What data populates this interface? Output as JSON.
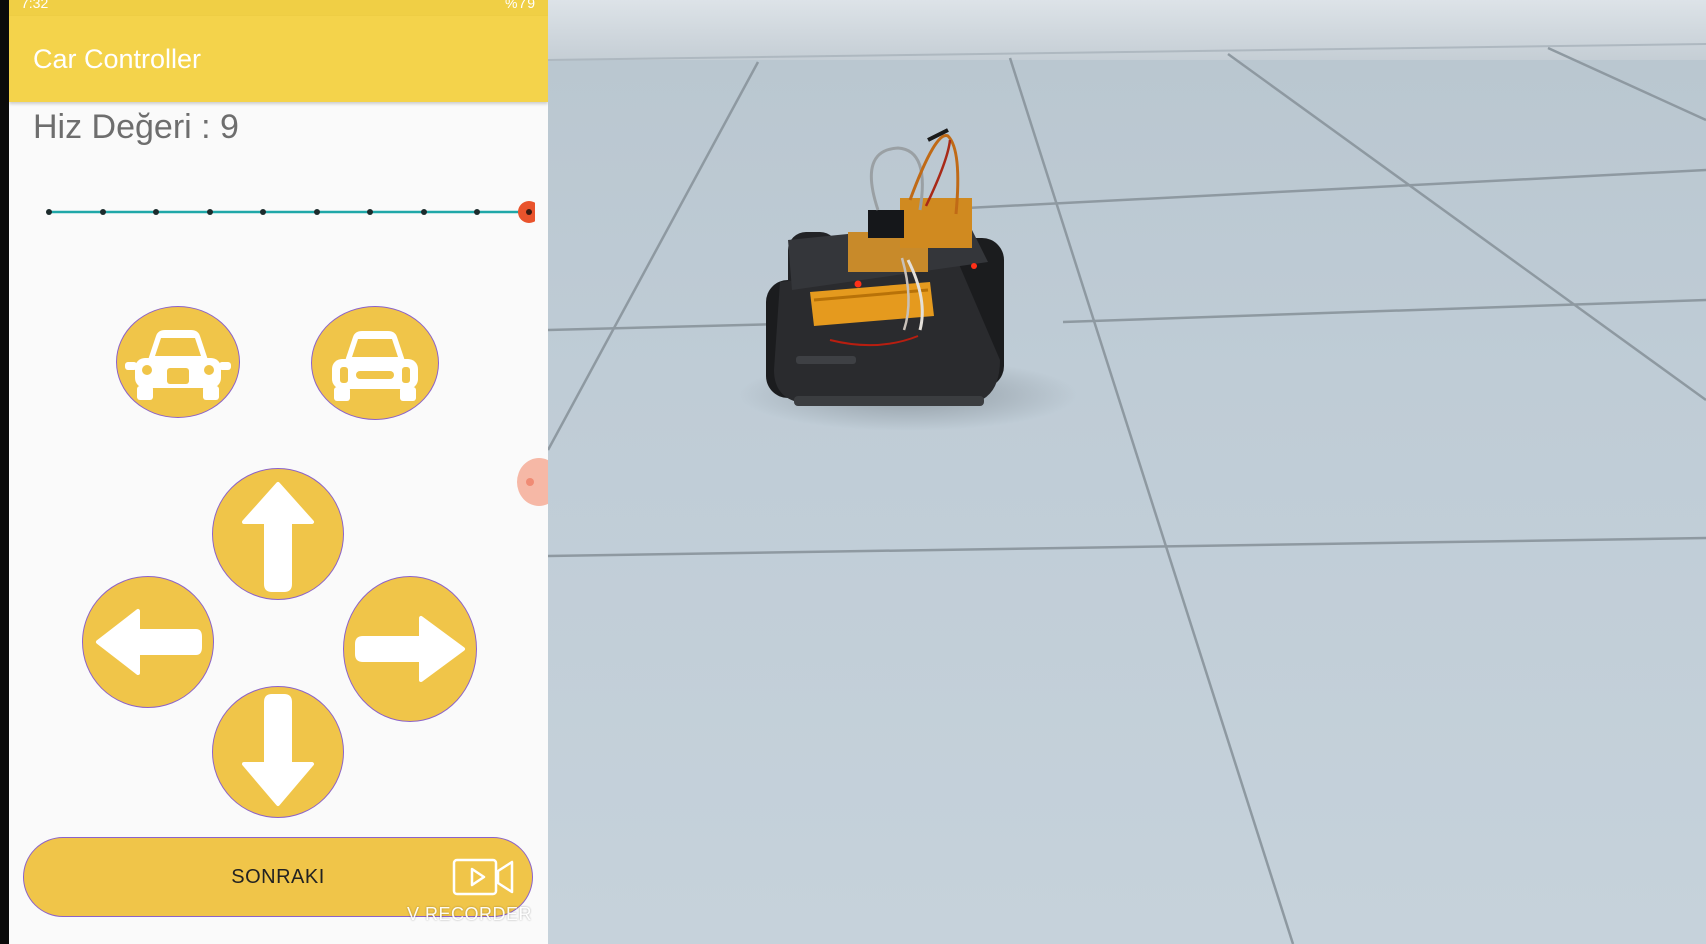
{
  "status_bar": {
    "time": "7:32",
    "battery": "%79"
  },
  "app_bar": {
    "title": "Car Controller"
  },
  "speed": {
    "label": "Hiz Değeri : 9",
    "value": 9,
    "min": 0,
    "max": 9
  },
  "buttons": {
    "car_left_icon": "car-front-icon",
    "car_right_icon": "car-front-icon",
    "up_icon": "arrow-up-icon",
    "left_icon": "arrow-left-icon",
    "right_icon": "arrow-right-icon",
    "down_icon": "arrow-down-icon",
    "next_label": "SONRAKI"
  },
  "overlay": {
    "recorder_label": "V RECORDER",
    "recorder_icon": "video-camera-icon"
  },
  "colors": {
    "primary": "#f4d34b",
    "button_fill": "#f0c549",
    "button_border": "#8c63c8",
    "slider_track": "#1fa7a8",
    "slider_thumb": "#e9532c"
  }
}
